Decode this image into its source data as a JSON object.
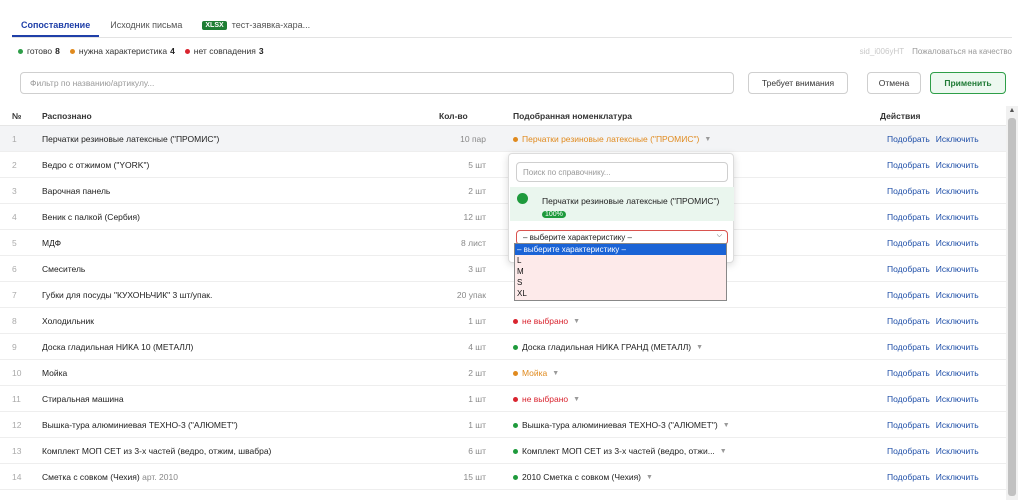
{
  "tabs": [
    {
      "label": "Сопоставление",
      "active": true
    },
    {
      "label": "Исходник письма",
      "active": false
    },
    {
      "label": "тест-заявка-хара...",
      "badge": "XLSX",
      "active": false
    }
  ],
  "status": {
    "ready_label": "готово",
    "ready_count": "8",
    "ready_color": "#2e9e48",
    "needs_label": "нужна характеристика",
    "needs_count": "4",
    "needs_color": "#e08a1e",
    "nomatch_label": "нет совпадения",
    "nomatch_count": "3",
    "nomatch_color": "#d9242f",
    "sid": "sid_i006yHT",
    "feedback": "Пожаловаться на качество"
  },
  "toolbar": {
    "filter_placeholder": "Фильтр по названию/артикулу...",
    "attention_label": "Требует внимания",
    "cancel_label": "Отмена",
    "apply_label": "Применить"
  },
  "columns": {
    "num": "№",
    "recognized": "Распознано",
    "qty": "Кол-во",
    "matched": "Подобранная номенклатура",
    "actions": "Действия"
  },
  "actions": {
    "pick": "Подобрать",
    "exclude": "Исключить"
  },
  "rows": [
    {
      "num": "1",
      "name": "Перчатки резиновые латексные (\"ПРОМИС\")",
      "art": "",
      "qty": "10 пар",
      "match": "Перчатки резиновые латексные (\"ПРОМИС\")",
      "status": "orange"
    },
    {
      "num": "2",
      "name": "Ведро с отжимом (\"YORK\")",
      "art": "",
      "qty": "5 шт",
      "match": "",
      "status": "none"
    },
    {
      "num": "3",
      "name": "Варочная панель",
      "art": "",
      "qty": "2 шт",
      "match": "",
      "status": "none"
    },
    {
      "num": "4",
      "name": "Веник с палкой (Сербия)",
      "art": "",
      "qty": "12 шт",
      "match": "",
      "status": "none"
    },
    {
      "num": "5",
      "name": "МДФ",
      "art": "",
      "qty": "8 лист",
      "match": "",
      "status": "none"
    },
    {
      "num": "6",
      "name": "Смеситель",
      "art": "",
      "qty": "3 шт",
      "match": "",
      "status": "none"
    },
    {
      "num": "7",
      "name": "Губки для посуды \"КУХОНЬЧИК\" 3 шт/упак.",
      "art": "",
      "qty": "20 упак",
      "match": "",
      "status": "none"
    },
    {
      "num": "8",
      "name": "Холодильник",
      "art": "",
      "qty": "1 шт",
      "match": "не выбрано",
      "status": "red"
    },
    {
      "num": "9",
      "name": "Доска гладильная НИКА 10 (МЕТАЛЛ)",
      "art": "",
      "qty": "4 шт",
      "match": "Доска гладильная НИКА ГРАНД (МЕТАЛЛ)",
      "status": "green"
    },
    {
      "num": "10",
      "name": "Мойка",
      "art": "",
      "qty": "2 шт",
      "match": "Мойка",
      "status": "orange"
    },
    {
      "num": "11",
      "name": "Стиральная машина",
      "art": "",
      "qty": "1 шт",
      "match": "не выбрано",
      "status": "red"
    },
    {
      "num": "12",
      "name": "Вышка-тура алюминиевая ТЕХНО-3 (\"АЛЮМЕТ\")",
      "art": "",
      "qty": "1 шт",
      "match": "Вышка-тура алюминиевая ТЕХНО-3 (\"АЛЮМЕТ\")",
      "status": "green"
    },
    {
      "num": "13",
      "name": "Комплект МОП СЕТ из 3-х частей (ведро, отжим, швабра)",
      "art": "",
      "qty": "6 шт",
      "match": "Комплект МОП СЕТ из 3-х частей (ведро, отжи...",
      "status": "green"
    },
    {
      "num": "14",
      "name": "Сметка с совком (Чехия)",
      "art": "арт. 2010",
      "qty": "15 шт",
      "match": "2010 Сметка с совком (Чехия)",
      "status": "green"
    }
  ],
  "status_colors": {
    "green": "#1e9a3c",
    "orange": "#e08a1e",
    "red": "#d9242f"
  },
  "popup": {
    "search_placeholder": "Поиск по справочнику...",
    "item_name": "Перчатки резиновые латексные (\"ПРОМИС\")",
    "item_percent": "100%",
    "select_value": "– выберите характеристику –",
    "options": [
      "– выберите характеристику –",
      "L",
      "M",
      "S",
      "XL"
    ]
  }
}
